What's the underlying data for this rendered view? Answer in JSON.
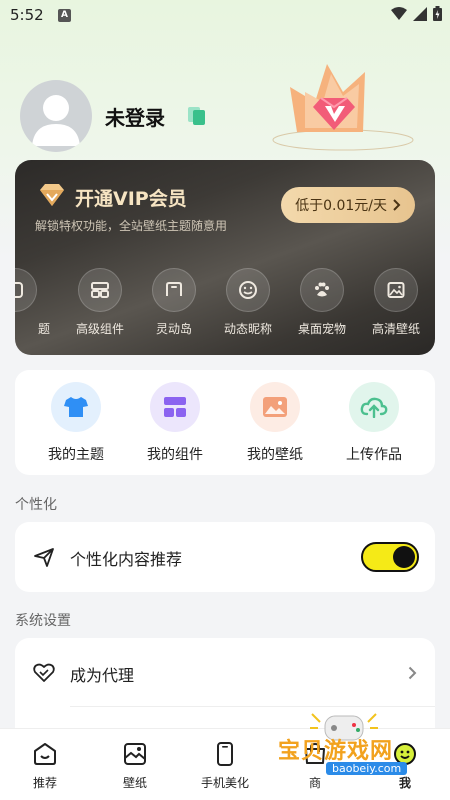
{
  "status_bar": {
    "time": "5:52",
    "notification_badge": "A"
  },
  "profile": {
    "login_status": "未登录"
  },
  "vip": {
    "title": "开通VIP会员",
    "subtitle": "解锁特权功能，全站壁纸主题随意用",
    "button": "低于0.01元/天",
    "features": [
      {
        "label": "题",
        "icon": "theme-icon"
      },
      {
        "label": "高级组件",
        "icon": "widget-icon"
      },
      {
        "label": "灵动岛",
        "icon": "dynamic-island-icon"
      },
      {
        "label": "动态昵称",
        "icon": "smiley-icon"
      },
      {
        "label": "桌面宠物",
        "icon": "paw-icon"
      },
      {
        "label": "高清壁纸",
        "icon": "image-icon"
      }
    ]
  },
  "quick_actions": [
    {
      "label": "我的主题",
      "icon": "tshirt-icon",
      "color": "#2f8ff5"
    },
    {
      "label": "我的组件",
      "icon": "widget-icon",
      "color": "#8b63f0"
    },
    {
      "label": "我的壁纸",
      "icon": "image-icon",
      "color": "#f3a07a"
    },
    {
      "label": "上传作品",
      "icon": "cloud-upload-icon",
      "color": "#4cc08f"
    }
  ],
  "personalization": {
    "section_label": "个性化",
    "content_recommend": {
      "label": "个性化内容推荐",
      "enabled": true
    }
  },
  "system_settings": {
    "section_label": "系统设置",
    "become_agent": "成为代理"
  },
  "bottom_nav": [
    {
      "label": "推荐",
      "icon": "home-face-icon"
    },
    {
      "label": "壁纸",
      "icon": "wallpaper-icon"
    },
    {
      "label": "手机美化",
      "icon": "phone-icon"
    },
    {
      "label": "商",
      "icon": "shop-icon"
    },
    {
      "label": "我",
      "icon": "me-icon",
      "active": true
    }
  ],
  "watermark": {
    "text": "宝贝游戏网",
    "url": "baobeiy.com"
  },
  "colors": {
    "toggle_on": "#f5ea17",
    "vip_gold": "#f6e4c2",
    "accent": "#2f8ff5"
  }
}
